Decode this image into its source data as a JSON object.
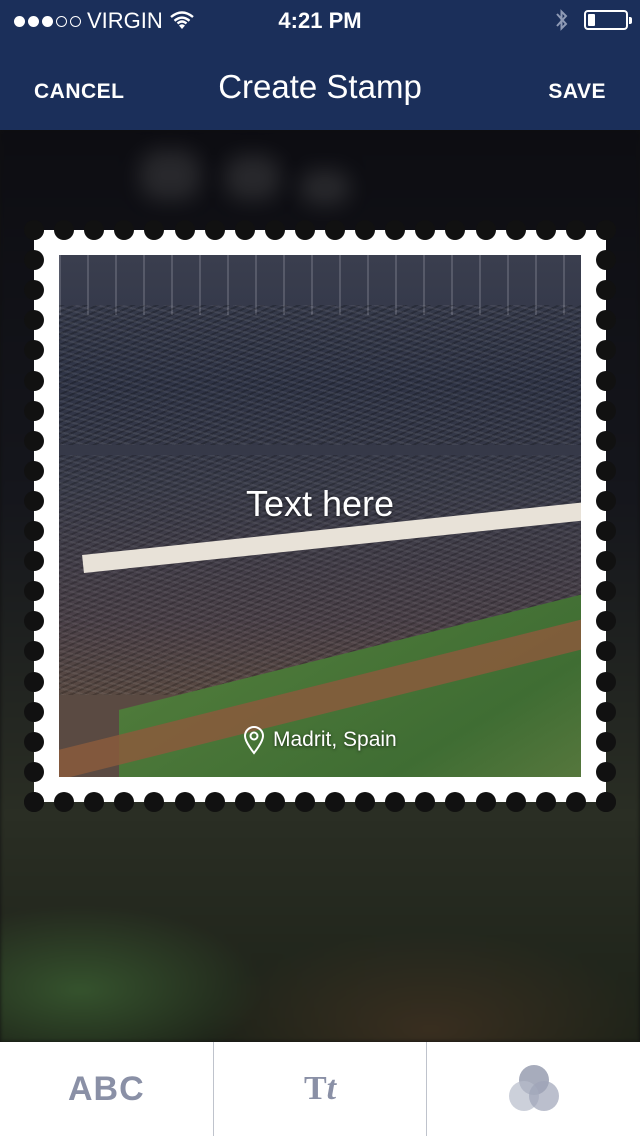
{
  "status_bar": {
    "carrier": "VIRGIN",
    "time": "4:21 PM",
    "signal_filled": 3,
    "signal_total": 5,
    "battery_level": 0.2
  },
  "nav": {
    "cancel_label": "CANCEL",
    "title": "Create Stamp",
    "save_label": "SAVE"
  },
  "stamp": {
    "text": "Text here",
    "location": "Madrit, Spain"
  },
  "toolbar": {
    "text_tool_label": "ABC",
    "font_tool_label_upright": "T",
    "font_tool_label_italic": "t",
    "icons": [
      "text-tool",
      "font-tool",
      "filter-icon"
    ]
  },
  "colors": {
    "nav_background": "#1b2f5a",
    "toolbar_icon": "#8a90a6",
    "stamp_border": "#ffffff"
  }
}
